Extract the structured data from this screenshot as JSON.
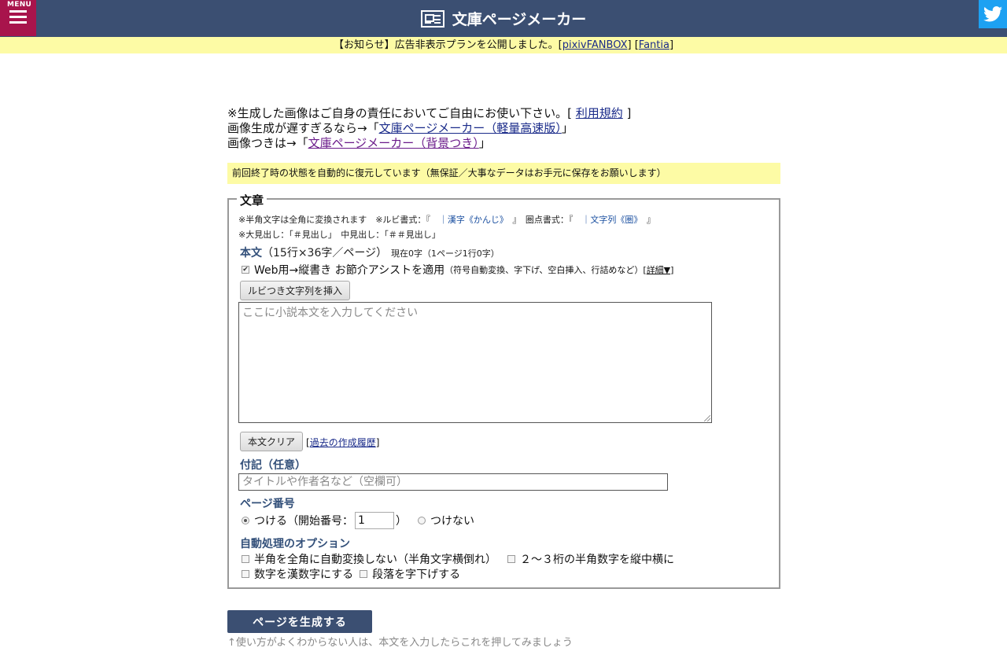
{
  "header": {
    "menu_label": "MENU",
    "title": "文庫ページメーカー"
  },
  "notice": {
    "prefix": "【お知らせ】広告非表示プランを公開しました。[",
    "link1": "pixivFANBOX",
    "mid": "] [",
    "link2": "Fantia",
    "suffix": "]"
  },
  "intro": {
    "line1_text": "※生成した画像はご自身の責任においてご自由にお使い下さい。[ ",
    "line1_link": "利用規約",
    "line1_end": " ]",
    "line2_text": "画像生成が遅すぎるなら→「",
    "line2_link": "文庫ページメーカー（軽量高速版）",
    "line2_end": "」",
    "line3_text": "画像つきは→「",
    "line3_link": "文庫ページメーカー（背景つき）",
    "line3_end": "」"
  },
  "restore_note": "前回終了時の状態を自動的に復元しています（無保証／大事なデータはお手元に保存をお願いします）",
  "form": {
    "legend": "文章",
    "hint1_a": "※半角文字は全角に変換されます　※ルビ書式：『　",
    "hint1_b": "｜漢字《かんじ》",
    "hint1_c": "　』　圏点書式：『　",
    "hint1_d": "｜文字列《圏》",
    "hint1_e": "　』",
    "hint2": "※大見出し：「＃見出し」　中見出し：「＃＃見出し」",
    "body_label": "本文",
    "body_spec": "（15行×36字／ページ）",
    "body_count": "現在0字（1ページ1行0字）",
    "assist_label": "Web用→縦書き お節介アシストを適用",
    "assist_note": "（符号自動変換、字下げ、空白挿入、行詰めなど）[",
    "assist_detail": "詳細▼",
    "assist_close": "]",
    "ruby_button": "ルビつき文字列を挿入",
    "body_placeholder": "ここに小説本文を入力してください",
    "clear_button": "本文クリア",
    "history_open": "[",
    "history_link": "過去の作成履歴",
    "history_close": "]",
    "note_label": "付記（任意）",
    "note_placeholder": "タイトルや作者名など（空欄可）",
    "page_label": "ページ番号",
    "page_on": "つける（開始番号：",
    "page_start": "1",
    "page_on_close": "）",
    "page_off": "つけない",
    "auto_label": "自動処理のオプション",
    "opt1": "半角を全角に自動変換しない（半角文字横倒れ）",
    "opt2": "２〜３桁の半角数字を縦中横に",
    "opt3": "数字を漢数字にする",
    "opt4": "段落を字下げする"
  },
  "generate_button": "ページを生成する",
  "footer_hint": "↑使い方がよくわからない人は、本文を入力したらこれを押してみましょう"
}
